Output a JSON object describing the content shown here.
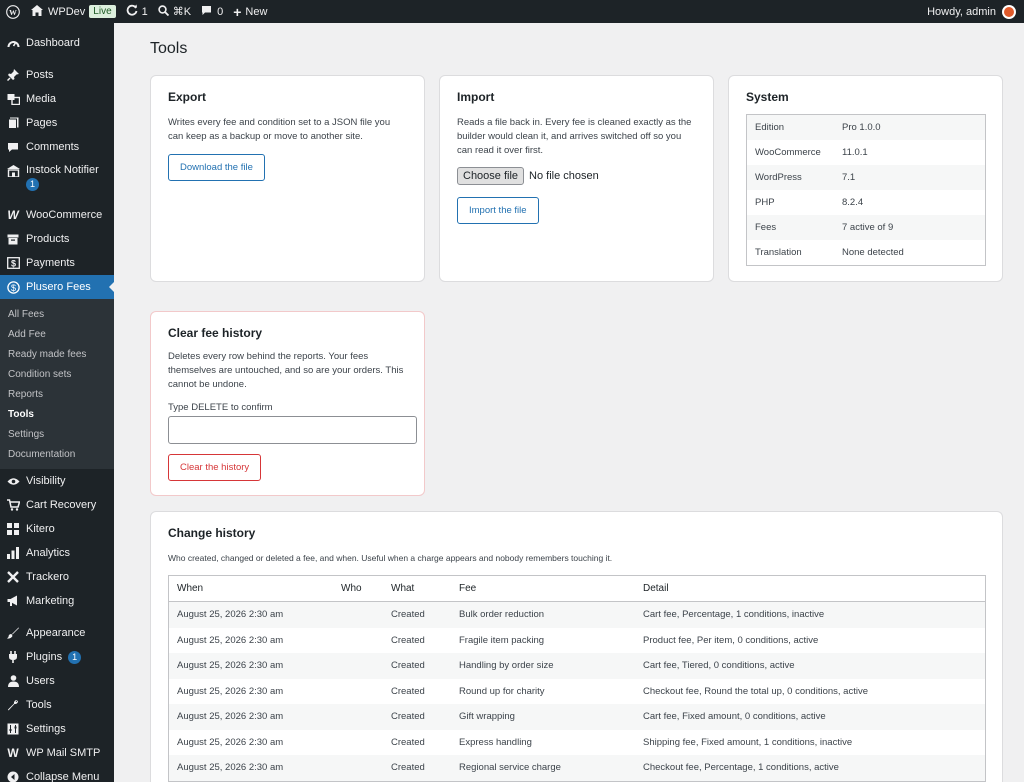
{
  "admin_bar": {
    "site_name": "WPDev",
    "live_badge": "Live",
    "updates_count": "1",
    "search_shortcut": "⌘K",
    "comments_count": "0",
    "new_label": "New",
    "greeting": "Howdy, admin"
  },
  "sidebar": {
    "items_top": [
      {
        "label": "Dashboard",
        "icon": "dashboard-icon"
      }
    ],
    "items_content": [
      {
        "label": "Posts",
        "icon": "pin-icon"
      },
      {
        "label": "Media",
        "icon": "media-icon"
      },
      {
        "label": "Pages",
        "icon": "pages-icon"
      },
      {
        "label": "Comments",
        "icon": "comment-icon"
      }
    ],
    "instock": {
      "label": "Instock Notifier",
      "badge": "1"
    },
    "items_shop": [
      {
        "label": "WooCommerce",
        "icon": "woocommerce-icon"
      },
      {
        "label": "Products",
        "icon": "products-icon"
      },
      {
        "label": "Payments",
        "icon": "payments-icon"
      }
    ],
    "current": {
      "label": "Plusero Fees"
    },
    "submenu": [
      "All Fees",
      "Add Fee",
      "Ready made fees",
      "Condition sets",
      "Reports",
      "Tools",
      "Settings",
      "Documentation"
    ],
    "submenu_current": "Tools",
    "items_after": [
      {
        "label": "Visibility",
        "icon": "eye-icon"
      },
      {
        "label": "Cart Recovery",
        "icon": "cart-icon"
      },
      {
        "label": "Kitero",
        "icon": "grid-icon"
      },
      {
        "label": "Analytics",
        "icon": "analytics-icon"
      },
      {
        "label": "Trackero",
        "icon": "trackero-icon"
      },
      {
        "label": "Marketing",
        "icon": "megaphone-icon"
      }
    ],
    "items_admin": [
      {
        "label": "Appearance",
        "icon": "brush-icon"
      },
      {
        "label": "Plugins",
        "icon": "plugin-icon",
        "badge": "1"
      },
      {
        "label": "Users",
        "icon": "user-icon"
      },
      {
        "label": "Tools",
        "icon": "wrench-icon"
      },
      {
        "label": "Settings",
        "icon": "settings-icon"
      },
      {
        "label": "WP Mail SMTP",
        "icon": "mail-icon"
      },
      {
        "label": "Collapse Menu",
        "icon": "collapse-icon"
      }
    ]
  },
  "page": {
    "title": "Tools"
  },
  "export": {
    "title": "Export",
    "description": "Writes every fee and condition set to a JSON file you can keep as a backup or move to another site.",
    "button": "Download the file"
  },
  "import": {
    "title": "Import",
    "description": "Reads a file back in. Every fee is cleaned exactly as the builder would clean it, and arrives switched off so you can read it over first.",
    "file_button": "Choose file",
    "file_status": "No file chosen",
    "button": "Import the file"
  },
  "system": {
    "title": "System",
    "rows": [
      {
        "key": "Edition",
        "value": "Pro 1.0.0"
      },
      {
        "key": "WooCommerce",
        "value": "11.0.1"
      },
      {
        "key": "WordPress",
        "value": "7.1"
      },
      {
        "key": "PHP",
        "value": "8.2.4"
      },
      {
        "key": "Fees",
        "value": "7 active of 9"
      },
      {
        "key": "Translation",
        "value": "None detected"
      }
    ]
  },
  "clear_history": {
    "title": "Clear fee history",
    "description": "Deletes every row behind the reports. Your fees themselves are untouched, and so are your orders. This cannot be undone.",
    "confirm_label": "Type DELETE to confirm",
    "input_value": "",
    "button": "Clear the history"
  },
  "change_history": {
    "title": "Change history",
    "description": "Who created, changed or deleted a fee, and when. Useful when a charge appears and nobody remembers touching it.",
    "columns": [
      "When",
      "Who",
      "What",
      "Fee",
      "Detail"
    ],
    "rows": [
      {
        "when": "August 25, 2026 2:30 am",
        "who": "",
        "what": "Created",
        "fee": "Bulk order reduction",
        "detail": "Cart fee, Percentage, 1 conditions, inactive"
      },
      {
        "when": "August 25, 2026 2:30 am",
        "who": "",
        "what": "Created",
        "fee": "Fragile item packing",
        "detail": "Product fee, Per item, 0 conditions, active"
      },
      {
        "when": "August 25, 2026 2:30 am",
        "who": "",
        "what": "Created",
        "fee": "Handling by order size",
        "detail": "Cart fee, Tiered, 0 conditions, active"
      },
      {
        "when": "August 25, 2026 2:30 am",
        "who": "",
        "what": "Created",
        "fee": "Round up for charity",
        "detail": "Checkout fee, Round the total up, 0 conditions, active"
      },
      {
        "when": "August 25, 2026 2:30 am",
        "who": "",
        "what": "Created",
        "fee": "Gift wrapping",
        "detail": "Cart fee, Fixed amount, 0 conditions, active"
      },
      {
        "when": "August 25, 2026 2:30 am",
        "who": "",
        "what": "Created",
        "fee": "Express handling",
        "detail": "Shipping fee, Fixed amount, 1 conditions, inactive"
      },
      {
        "when": "August 25, 2026 2:30 am",
        "who": "",
        "what": "Created",
        "fee": "Regional service charge",
        "detail": "Checkout fee, Percentage, 1 conditions, active"
      }
    ]
  },
  "colors": {
    "admin_bar_bg": "#1d2327",
    "accent": "#2271b1",
    "danger": "#d63638",
    "live_badge": "#dcefdd"
  }
}
